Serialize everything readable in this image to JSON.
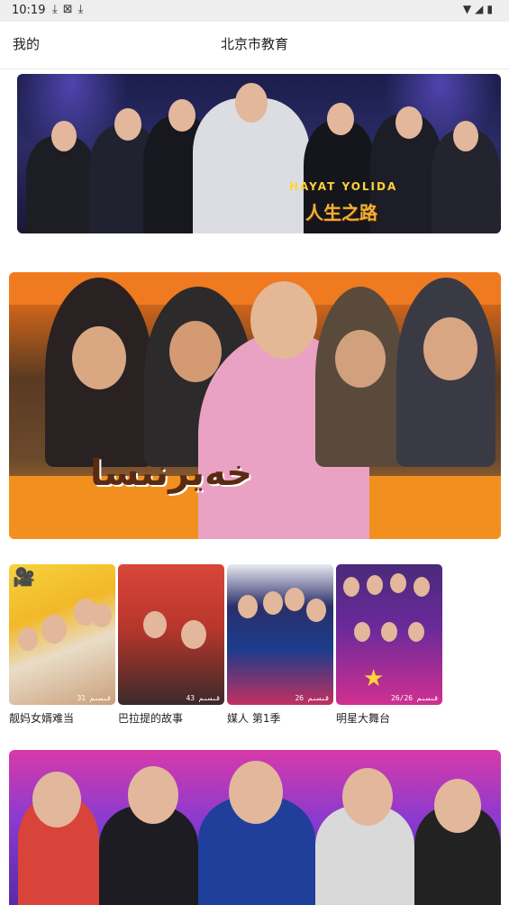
{
  "status_bar": {
    "time": "10:19",
    "notification_icons": [
      "download-icon",
      "a-box-icon",
      "download-icon"
    ],
    "system_icons": [
      "wifi-icon",
      "signal-icon",
      "battery-icon"
    ]
  },
  "app_bar": {
    "left_label": "我的",
    "title": "北京市教育"
  },
  "banners": [
    {
      "overlay_text": "HAYAT YOLIDA",
      "overlay_text_cn": "人生之路"
    },
    {
      "overlay_text": "خەيرنىسا"
    },
    {
      "overlay_text": ""
    }
  ],
  "series": [
    {
      "title": "靓妈女婿难当",
      "episodes": "31 قىسىم",
      "colors": [
        "#f6d23c",
        "#c9a07a"
      ]
    },
    {
      "title": "巴拉提的故事",
      "episodes": "43 قىسىم",
      "colors": [
        "#d43b2f",
        "#402a2a"
      ]
    },
    {
      "title": "媒人 第1季",
      "episodes": "26 قىسىم",
      "colors": [
        "#1b3c8c",
        "#c23060"
      ]
    },
    {
      "title": "明星大舞台",
      "episodes": "26/26 قىسىم",
      "colors": [
        "#6a2a9a",
        "#d03090"
      ]
    }
  ]
}
